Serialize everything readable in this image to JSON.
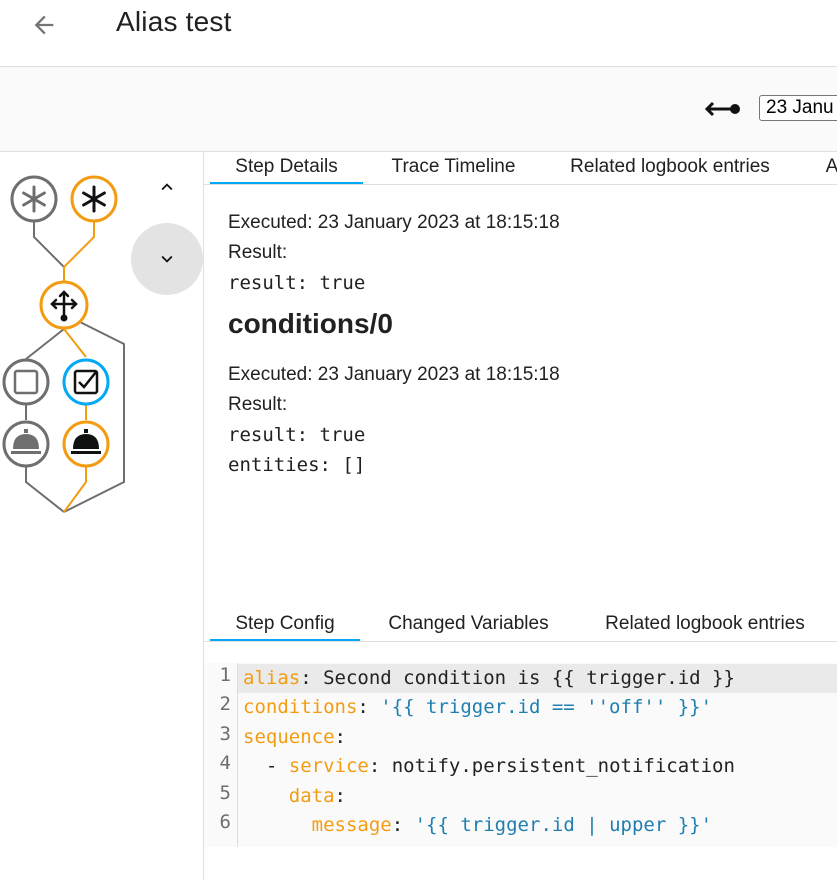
{
  "header": {
    "title": "Alias test"
  },
  "trace": {
    "selected": "23 Janu"
  },
  "colors": {
    "accent": "#03a9f4",
    "trace_active": "#f39c12",
    "inactive": "#6f6f6f"
  },
  "graph": {
    "icons": [
      "trigger-asterisk-icon",
      "trigger-asterisk-icon",
      "choose-branch-icon",
      "condition-checkbox-icon",
      "condition-checkbox-checked-icon",
      "service-bell-icon",
      "service-bell-icon"
    ]
  },
  "top_tabs": [
    "Step Details",
    "Trace Timeline",
    "Related logbook entries",
    "A"
  ],
  "step1": {
    "executed": "Executed: 23 January 2023 at 18:15:18",
    "result_label": "Result:",
    "result_yaml": "result: true"
  },
  "section_title": "conditions/0",
  "step2": {
    "executed": "Executed: 23 January 2023 at 18:15:18",
    "result_label": "Result:",
    "result_yaml_1": "result: true",
    "result_yaml_2": "entities: []"
  },
  "bottom_tabs": [
    "Step Config",
    "Changed Variables",
    "Related logbook entries"
  ],
  "code": {
    "line_numbers": [
      "1",
      "2",
      "3",
      "4",
      "5",
      "6"
    ],
    "l1": {
      "key": "alias",
      "sep": ": ",
      "val": "Second condition is {{ trigger.id }}"
    },
    "l2": {
      "key": "conditions",
      "sep": ": ",
      "val": "'{{ trigger.id == ''off'' }}'"
    },
    "l3": {
      "key": "sequence",
      "sep": ":"
    },
    "l4": {
      "indent": "  - ",
      "key": "service",
      "sep": ": ",
      "val": "notify.persistent_notification"
    },
    "l5": {
      "indent": "    ",
      "key": "data",
      "sep": ":"
    },
    "l6": {
      "indent": "      ",
      "key": "message",
      "sep": ": ",
      "val": "'{{ trigger.id | upper }}'"
    }
  }
}
